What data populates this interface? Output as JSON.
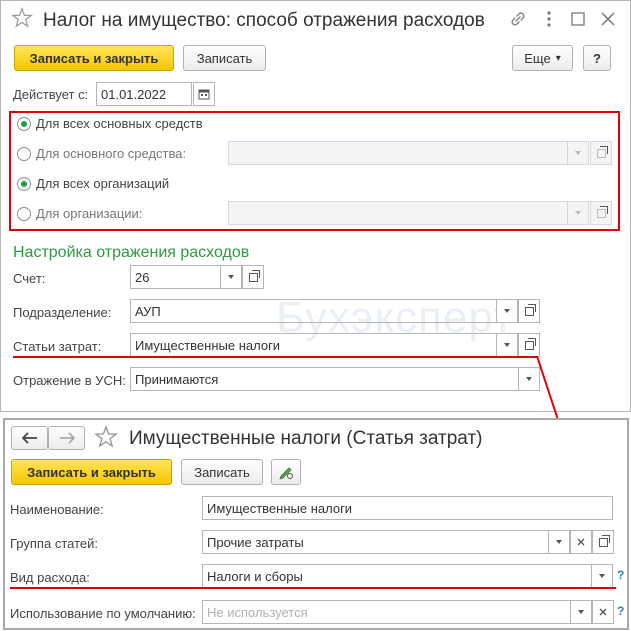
{
  "top": {
    "title": "Налог на имущество: способ отражения расходов",
    "save_close_label": "Записать и закрыть",
    "save_label": "Записать",
    "more_label": "Еще",
    "more_arrow": "▾",
    "help_label": "?",
    "effective_label": "Действует с:",
    "effective_date": "01.01.2022",
    "radios": [
      {
        "label": "Для всех основных средств",
        "checked": true
      },
      {
        "label": "Для основного средства:",
        "checked": false
      },
      {
        "label": "Для всех организаций",
        "checked": true
      },
      {
        "label": "Для организации:",
        "checked": false
      }
    ],
    "section_title": "Настройка отражения расходов",
    "fields": [
      {
        "label": "Счет:",
        "value": "26"
      },
      {
        "label": "Подразделение:",
        "value": "АУП"
      },
      {
        "label": "Статьи затрат:",
        "value": "Имущественные налоги"
      },
      {
        "label": "Отражение в УСН:",
        "value": "Принимаются"
      }
    ],
    "watermark": "Бухэксперт"
  },
  "bottom": {
    "title": "Имущественные налоги (Статья затрат)",
    "save_close_label": "Записать и закрыть",
    "save_label": "Записать",
    "fields": [
      {
        "label": "Наименование:",
        "value": "Имущественные налоги"
      },
      {
        "label": "Группа статей:",
        "value": "Прочие затраты"
      },
      {
        "label": "Вид расхода:",
        "value": "Налоги и сборы"
      },
      {
        "label": "Использование по умолчанию:",
        "placeholder": "Не используется"
      }
    ],
    "help_mark": "?"
  },
  "colors": {
    "accent_yellow": "#f6c600",
    "section_green": "#2f9a44",
    "highlight_red": "#e0000a",
    "radio_green": "#1d9d4d"
  }
}
